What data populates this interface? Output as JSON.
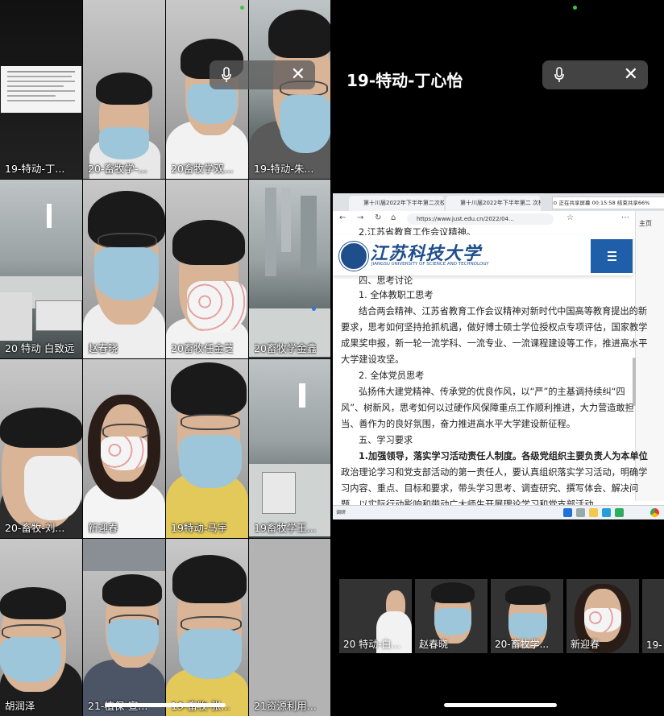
{
  "left_grid": {
    "tiles": [
      {
        "label": "19-特动-丁..."
      },
      {
        "label": "20-畜牧学-..."
      },
      {
        "label": "20畜牧学双..."
      },
      {
        "label": "19-特动-朱..."
      },
      {
        "label": "20 特动 白致远"
      },
      {
        "label": "赵春晓"
      },
      {
        "label": "20畜牧任金芝"
      },
      {
        "label": "20畜牧学金鑫"
      },
      {
        "label": "20-畜牧-刘..."
      },
      {
        "label": "新迎春"
      },
      {
        "label": "19特动-马宇"
      },
      {
        "label": "19畜牧学王..."
      },
      {
        "label": "胡润泽"
      },
      {
        "label": "21-植保-宣..."
      },
      {
        "label": "19-畜牧-张..."
      },
      {
        "label": "21资源利用..."
      }
    ],
    "icons": {
      "mic": "mic-icon",
      "close": "close-icon"
    },
    "close_glyph": "✕"
  },
  "right_panel": {
    "speaker_name": "19-特动-丁心怡",
    "close_glyph": "✕",
    "browser": {
      "tab1": "第十川届2022年下半年第二次校",
      "tab2": "第十川届2022年下半年第二 次校",
      "address": "https://www.just.edu.cn/2022/04...",
      "float_bar": "⊙ 正在共享屏幕    00:15:58    结束共享66%",
      "sidebar_label": "主页"
    },
    "site": {
      "logo_cn": "江苏科技大学",
      "logo_en": "JIANGSU UNIVERSITY OF SCIENCE AND TECHNOLOGY"
    },
    "doc_lines": [
      "2.江苏省教育工作会议精神。",
      "四、思考讨论",
      "1. 全体教职工思考",
      "结合两会精神、江苏省教育工作会议精神对新时代中国高等教育提出的新",
      "要求，思考如何坚持抢抓机遇，做好博士硕士学位授权点专项评估，国家教学",
      "成果奖申报，新一轮一流学科、一流专业、一流课程建设等工作，推进高水平",
      "大学建设攻坚。",
      "2. 全体党员思考",
      "弘扬伟大建党精神、传承党的优良作风，以“严”的主基调持续纠“四",
      "风”、树新风，思考如何以过硬作风保障重点工作顺利推进，大力营造敢担",
      "当、善作为的良好氛围，奋力推进高水平大学建设新征程。",
      "五、学习要求",
      "1.加强领导，落实学习活动责任人制度。各级党组织主要负责人为本单位",
      "政治理论学习和党支部活动的第一责任人，要认真组织落实学习活动，明确学",
      "习内容、重点、目标和要求，带头学习思考、调查研究、撰写体会、解决问",
      "题，以实际行动影响和带动广大师生开展理论学习和党支部活动。"
    ],
    "taskbar_label": "调研",
    "thumbs": [
      {
        "label": "20 特动-白..."
      },
      {
        "label": "赵春晓"
      },
      {
        "label": "20-畜牧学..."
      },
      {
        "label": "新迎春"
      },
      {
        "label": "19-"
      }
    ]
  },
  "colors": {
    "university_blue": "#1f4e8c",
    "menu_blue": "#1f5ea8",
    "green_dot": "#3fc24a"
  }
}
